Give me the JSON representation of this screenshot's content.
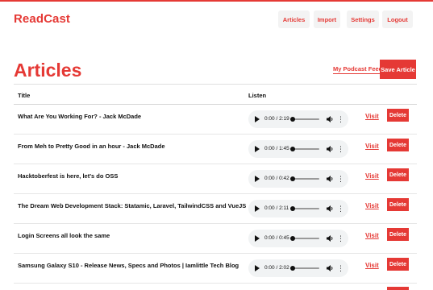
{
  "header": {
    "brand": "ReadCast",
    "nav": [
      "Articles",
      "Import",
      "Settings",
      "Logout"
    ]
  },
  "page": {
    "title": "Articles",
    "feed_link": "My Podcast Feed",
    "save_button": "Save Article"
  },
  "table": {
    "columns": {
      "title": "Title",
      "listen": "Listen"
    },
    "visit_label": "Visit",
    "delete_label": "Delete",
    "rows": [
      {
        "title": "What Are You Working For? - Jack McDade",
        "time": "0:00 / 2:19"
      },
      {
        "title": "From Meh to Pretty Good in an hour - Jack McDade",
        "time": "0:00 / 1:45"
      },
      {
        "title": "Hacktoberfest is here, let's do OSS",
        "time": "0:00 / 0:42"
      },
      {
        "title": "The Dream Web Development Stack: Statamic, Laravel, TailwindCSS and VueJS",
        "time": "0:00 / 2:11"
      },
      {
        "title": "Login Screens all look the same",
        "time": "0:00 / 0:45"
      },
      {
        "title": "Samsung Galaxy S10 - Release News, Specs and Photos | Iamlittle Tech Blog",
        "time": "0:00 / 2:02"
      }
    ]
  },
  "colors": {
    "accent": "#e53935",
    "nav_bg": "#f3f3f3",
    "player_bg": "#f1f3f4"
  },
  "icons": [
    "play-icon",
    "volume-icon",
    "more-options-icon"
  ]
}
